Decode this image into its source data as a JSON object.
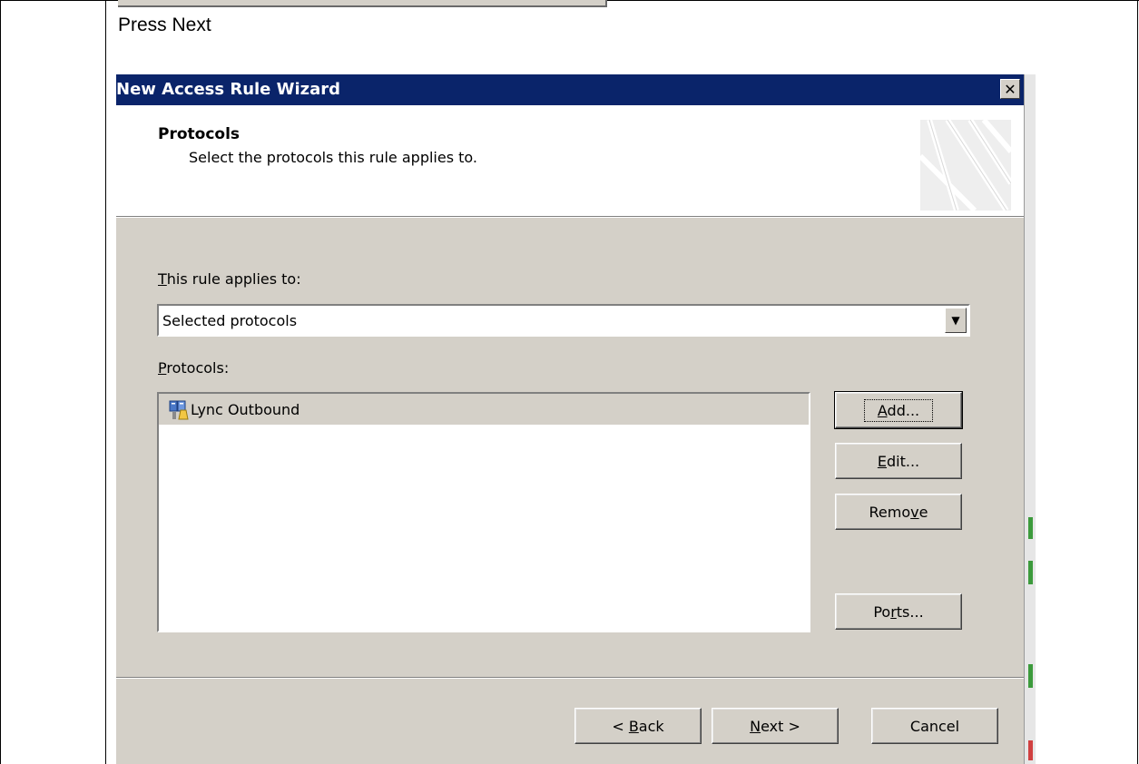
{
  "document": {
    "instruction": "Press Next"
  },
  "wizard": {
    "title": "New Access Rule Wizard",
    "close_glyph": "✕",
    "header": {
      "title": "Protocols",
      "subtitle": "Select the protocols this rule applies to."
    },
    "applies_label_ul": "T",
    "applies_label_rest": "his rule applies to:",
    "applies_value": "Selected protocols",
    "protocols_label_ul": "P",
    "protocols_label_rest": "rotocols:",
    "protocols": [
      {
        "name": "Lync Outbound",
        "icon": "protocol-definition-icon"
      }
    ],
    "buttons": {
      "add": {
        "ul": "A",
        "rest": "dd..."
      },
      "edit": {
        "ul": "E",
        "rest": "dit..."
      },
      "remove": {
        "pre": "Remo",
        "ul": "v",
        "post": "e"
      },
      "ports": {
        "pre": "Po",
        "ul": "r",
        "post": "ts..."
      },
      "back": {
        "pre": "< ",
        "ul": "B",
        "post": "ack"
      },
      "next": {
        "ul": "N",
        "post": "ext >"
      },
      "cancel": "Cancel"
    },
    "colors": {
      "titlebar": "#0a246a",
      "face": "#d4d0c8"
    }
  }
}
